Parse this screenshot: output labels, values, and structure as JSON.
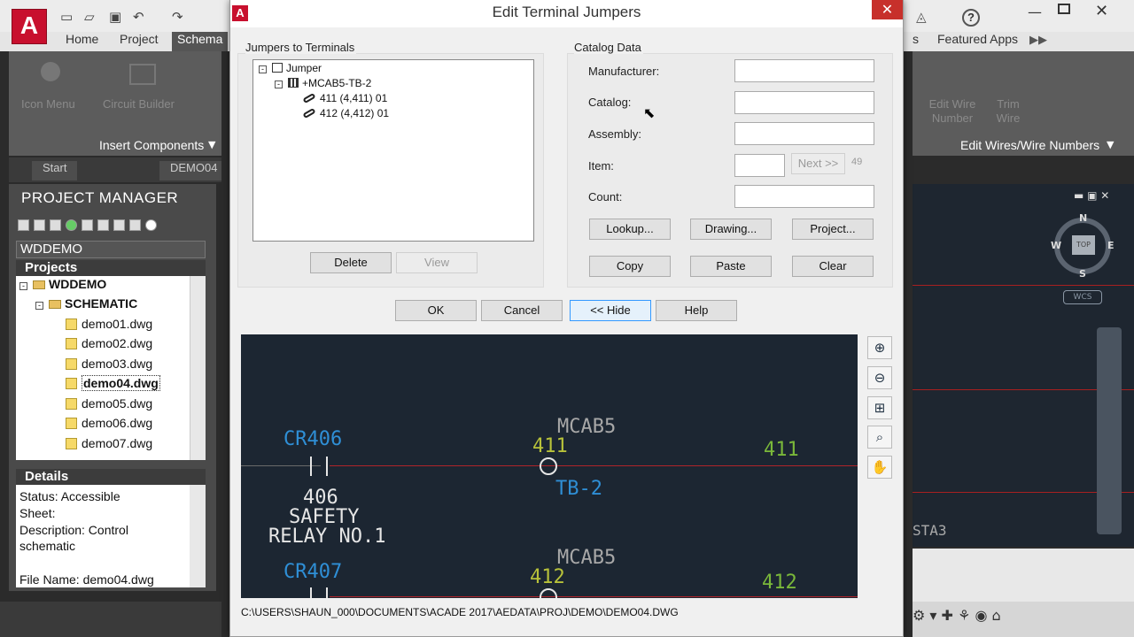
{
  "app": {
    "logo_letter": "A",
    "ribbon_tabs": [
      "Home",
      "Project",
      "Schema"
    ],
    "right_ribbon_tabs": [
      "s",
      "Featured Apps"
    ],
    "ribbon_buttons": [
      "Icon Menu",
      "Circuit Builder"
    ],
    "right_ribbon_buttons": [
      "Edit Wire Number",
      "Trim Wire"
    ],
    "insert_components_panel": "Insert Components",
    "edit_wires_panel": "Edit Wires/Wire Numbers",
    "doc_tabs": [
      "Start",
      "DEMO04"
    ]
  },
  "project_manager": {
    "title": "PROJECT MANAGER",
    "project_select": "WDDEMO",
    "projects_header": "Projects",
    "tree": [
      {
        "label": "WDDEMO",
        "type": "project"
      },
      {
        "label": "SCHEMATIC",
        "type": "folder"
      },
      {
        "label": "demo01.dwg",
        "type": "dwg"
      },
      {
        "label": "demo02.dwg",
        "type": "dwg"
      },
      {
        "label": "demo03.dwg",
        "type": "dwg"
      },
      {
        "label": "demo04.dwg",
        "type": "dwg",
        "selected": true
      },
      {
        "label": "demo05.dwg",
        "type": "dwg"
      },
      {
        "label": "demo06.dwg",
        "type": "dwg"
      },
      {
        "label": "demo07.dwg",
        "type": "dwg"
      }
    ],
    "details_header": "Details",
    "details": {
      "status": "Status: Accessible",
      "sheet": "Sheet:",
      "description_1": "Description: Control",
      "description_2": "schematic",
      "file_name": "File Name: demo04.dwg"
    }
  },
  "viewcube": {
    "n": "N",
    "s": "S",
    "w": "W",
    "e": "E",
    "top": "TOP",
    "wcs": "WCS"
  },
  "right_canvas_text": "STA3",
  "dialog": {
    "title": "Edit Terminal Jumpers",
    "close_glyph": "✕",
    "jumpers_group_label": "Jumpers to Terminals",
    "tree": {
      "root": "Jumper",
      "terminal_strip": "+MCAB5-TB-2",
      "items": [
        "411 (4,411) 01",
        "412 (4,412) 01"
      ]
    },
    "delete_label": "Delete",
    "view_label": "View",
    "catalog_group_label": "Catalog Data",
    "fields": {
      "manufacturer_label": "Manufacturer:",
      "manufacturer_value": "",
      "catalog_label": "Catalog:",
      "catalog_value": "",
      "assembly_label": "Assembly:",
      "assembly_value": "",
      "item_label": "Item:",
      "item_value": "",
      "next_label": "Next >>",
      "next_count": "49",
      "count_label": "Count:",
      "count_value": ""
    },
    "lookup_label": "Lookup...",
    "drawing_label": "Drawing...",
    "project_label": "Project...",
    "copy_label": "Copy",
    "paste_label": "Paste",
    "clear_label": "Clear",
    "ok_label": "OK",
    "cancel_label": "Cancel",
    "hide_label": "<< Hide",
    "help_label": "Help",
    "path": "C:\\USERS\\SHAUN_000\\DOCUMENTS\\ACADE 2017\\AEDATA\\PROJ\\DEMO\\DEMO04.DWG"
  },
  "preview": {
    "cr406": "CR406",
    "cr407": "CR407",
    "mcab5_a": "MCAB5",
    "mcab5_b": "MCAB5",
    "wire_411_left": "411",
    "wire_411_right": "411",
    "wire_412_left": "412",
    "wire_412_right": "412",
    "tb2": "TB-2",
    "relay_line1": "406",
    "relay_line2": "SAFETY",
    "relay_line3": "RELAY NO.1"
  },
  "colors": {
    "preview_bg": "#1c2632",
    "wire_red": "#b0242a",
    "cyan_text": "#2f8fd6",
    "yellow_text": "#b8c23a",
    "green_text": "#7ab83a",
    "white_text": "#e6e6e6",
    "gray_text": "#a8a8a8",
    "autocad_red": "#c8102e"
  }
}
